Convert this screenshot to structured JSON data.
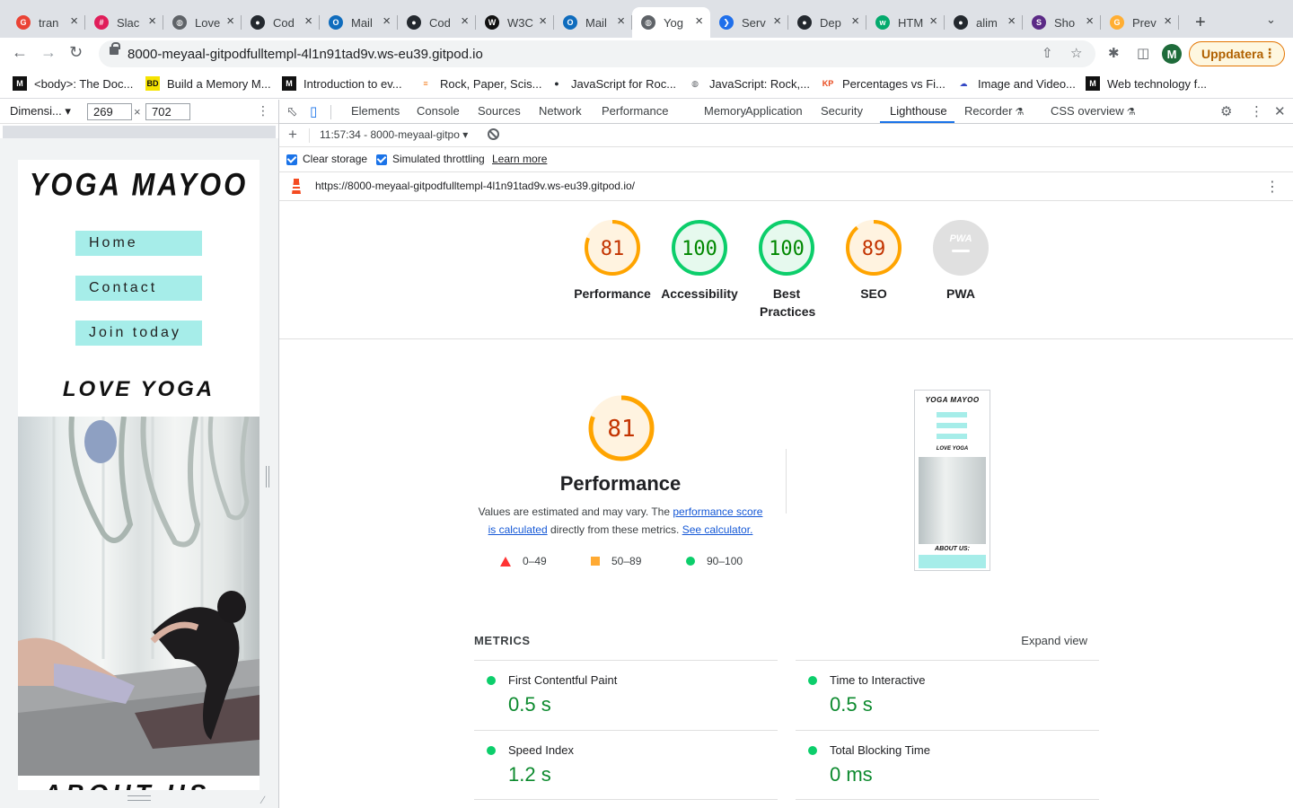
{
  "tabs": [
    {
      "title": "tran",
      "icon": "google-icon",
      "color": "#ea4335",
      "active": false
    },
    {
      "title": "Slac",
      "icon": "slack-icon",
      "color": "#e01e5a",
      "active": false
    },
    {
      "title": "Love",
      "icon": "globe-icon",
      "color": "#5f6368",
      "active": false
    },
    {
      "title": "Cod",
      "icon": "github-icon",
      "color": "#24292f",
      "active": false
    },
    {
      "title": "Mail",
      "icon": "outlook-icon",
      "color": "#0f6cbd",
      "active": false
    },
    {
      "title": "Cod",
      "icon": "github-icon",
      "color": "#24292f",
      "active": false
    },
    {
      "title": "W3C",
      "icon": "w3c-icon",
      "color": "#111111",
      "active": false
    },
    {
      "title": "Mail",
      "icon": "outlook-icon",
      "color": "#0f6cbd",
      "active": false
    },
    {
      "title": "Yog",
      "icon": "globe-icon",
      "color": "#5f6368",
      "active": true
    },
    {
      "title": "Serv",
      "icon": "vscode-icon",
      "color": "#1f6feb",
      "active": false
    },
    {
      "title": "Dep",
      "icon": "github-icon",
      "color": "#24292f",
      "active": false
    },
    {
      "title": "HTM",
      "icon": "w3schools-icon",
      "color": "#04aa6d",
      "active": false
    },
    {
      "title": "alim",
      "icon": "github-icon",
      "color": "#24292f",
      "active": false
    },
    {
      "title": "Sho",
      "icon": "shots-icon",
      "color": "#5b2a86",
      "active": false
    },
    {
      "title": "Prev",
      "icon": "gitpod-icon",
      "color": "#ffae33",
      "active": false
    }
  ],
  "toolbar": {
    "url": "8000-meyaal-gitpodfulltempl-4l1n91tad9v.ws-eu39.gitpod.io",
    "avatar_letter": "M",
    "update_label": "Uppdatera"
  },
  "bookmarks": [
    {
      "label": "<body>: The Doc...",
      "icon": "mdn-icon",
      "color": "#111111"
    },
    {
      "label": "Build a Memory M...",
      "icon": "bd-icon",
      "color": "#f6e300"
    },
    {
      "label": "Introduction to ev...",
      "icon": "mdn-icon",
      "color": "#111111"
    },
    {
      "label": "Rock, Paper, Scis...",
      "icon": "stackoverflow-icon",
      "color": "#f48024"
    },
    {
      "label": "JavaScript for Roc...",
      "icon": "github-icon",
      "color": "#24292f"
    },
    {
      "label": "JavaScript: Rock,...",
      "icon": "globe-icon",
      "color": "#5f6368"
    },
    {
      "label": "Percentages vs Fi...",
      "icon": "kp-icon",
      "color": "#e8491d"
    },
    {
      "label": "Image and Video...",
      "icon": "cloud-icon",
      "color": "#3448c5"
    },
    {
      "label": "Web technology f...",
      "icon": "mdn-icon",
      "color": "#111111"
    }
  ],
  "device": {
    "select_label": "Dimensi...",
    "width": "269",
    "height": "702"
  },
  "site": {
    "title": "YOGA MAYOO",
    "nav": [
      "Home",
      "Contact",
      "Join today"
    ],
    "heading": "LOVE YOGA",
    "about_peek": "ABOUT US"
  },
  "devtools": {
    "tabs": [
      "Elements",
      "Console",
      "Sources",
      "Network",
      "Performance",
      "Memory",
      "Application",
      "Security",
      "Lighthouse",
      "Recorder",
      "CSS overview"
    ],
    "active_tab": "Lighthouse"
  },
  "lighthouse": {
    "report_select": "11:57:34 - 8000-meyaal-gitpo",
    "clear_storage": "Clear storage",
    "simulated_throttling": "Simulated throttling",
    "learn_more": "Learn more",
    "report_url": "https://8000-meyaal-gitpodfulltempl-4l1n91tad9v.ws-eu39.gitpod.io/",
    "scores": [
      {
        "label": "Performance",
        "score": 81,
        "status": "average"
      },
      {
        "label": "Accessibility",
        "score": 100,
        "status": "pass"
      },
      {
        "label": "Best Practices",
        "score": 100,
        "status": "pass"
      },
      {
        "label": "SEO",
        "score": 89,
        "status": "average"
      },
      {
        "label": "PWA",
        "score": null,
        "status": "na",
        "badge": "PWA"
      }
    ],
    "performance": {
      "score": 81,
      "title": "Performance",
      "desc_prefix": "Values are estimated and may vary. The ",
      "desc_link1": "performance score is calculated",
      "desc_middle": " directly from these metrics. ",
      "desc_link2": "See calculator.",
      "legend": [
        {
          "range": "0–49",
          "shape": "triangle",
          "color": "#ff3333"
        },
        {
          "range": "50–89",
          "shape": "square",
          "color": "#ffaa33"
        },
        {
          "range": "90–100",
          "shape": "circle",
          "color": "#0cce6b"
        }
      ]
    },
    "metrics_title": "METRICS",
    "expand_view": "Expand view",
    "metrics": [
      {
        "name": "First Contentful Paint",
        "value": "0.5 s"
      },
      {
        "name": "Time to Interactive",
        "value": "0.5 s"
      },
      {
        "name": "Speed Index",
        "value": "1.2 s"
      },
      {
        "name": "Total Blocking Time",
        "value": "0 ms"
      }
    ],
    "thumbnail": {
      "title": "YOGA MAYOO",
      "heading": "LOVE YOGA",
      "about": "ABOUT US:"
    }
  },
  "colors": {
    "pass": "#0cce6b",
    "pass_text": "#008800",
    "average": "#ffa400",
    "average_text": "#c33300",
    "na": "#e0e0e0",
    "nav_button": "#a6ede9",
    "accent": "#1a73e8"
  }
}
